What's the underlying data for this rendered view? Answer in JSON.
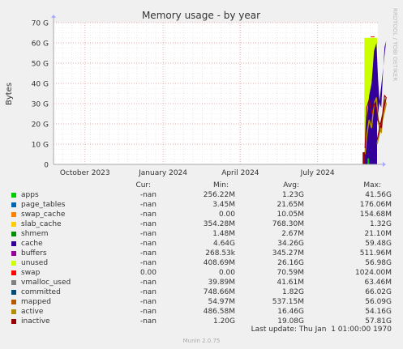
{
  "chart_data": {
    "type": "area",
    "title": "Memory usage - by year",
    "ylabel": "Bytes",
    "ylim": [
      0,
      70
    ],
    "yunit": "G",
    "y_ticks": [
      "0",
      "10 G",
      "20 G",
      "30 G",
      "40 G",
      "50 G",
      "60 G",
      "70 G"
    ],
    "x_ticks": [
      "October 2023",
      "January 2024",
      "April 2024",
      "July 2024"
    ],
    "x_range": [
      "2023-08-25",
      "2024-09-10"
    ],
    "grid": true,
    "data_start": "2024-08-25",
    "columns": {
      "cur": "Cur:",
      "min": "Min:",
      "avg": "Avg:",
      "max": "Max:"
    },
    "series": [
      {
        "name": "apps",
        "color": "#00cc00",
        "cur": "-nan",
        "min": "256.22M",
        "avg": "1.23G",
        "max": "41.56G"
      },
      {
        "name": "page_tables",
        "color": "#0066b3",
        "cur": "-nan",
        "min": "3.45M",
        "avg": "21.65M",
        "max": "176.06M"
      },
      {
        "name": "swap_cache",
        "color": "#ff8000",
        "cur": "-nan",
        "min": "0.00",
        "avg": "10.05M",
        "max": "154.68M"
      },
      {
        "name": "slab_cache",
        "color": "#ffcc00",
        "cur": "-nan",
        "min": "354.28M",
        "avg": "768.30M",
        "max": "1.32G"
      },
      {
        "name": "shmem",
        "color": "#008f00",
        "cur": "-nan",
        "min": "1.48M",
        "avg": "2.67M",
        "max": "21.10M"
      },
      {
        "name": "cache",
        "color": "#330099",
        "cur": "-nan",
        "min": "4.64G",
        "avg": "34.26G",
        "max": "59.48G"
      },
      {
        "name": "buffers",
        "color": "#990099",
        "cur": "-nan",
        "min": "268.53k",
        "avg": "345.27M",
        "max": "511.96M"
      },
      {
        "name": "unused",
        "color": "#ccff00",
        "cur": "-nan",
        "min": "408.69M",
        "avg": "26.16G",
        "max": "56.98G"
      },
      {
        "name": "swap",
        "color": "#ff0000",
        "cur": "0.00",
        "min": "0.00",
        "avg": "70.59M",
        "max": "1024.00M"
      },
      {
        "name": "vmalloc_used",
        "color": "#808080",
        "cur": "-nan",
        "min": "39.89M",
        "avg": "41.61M",
        "max": "63.46M"
      },
      {
        "name": "committed",
        "color": "#004d7a",
        "cur": "-nan",
        "min": "748.66M",
        "avg": "1.82G",
        "max": "66.02G"
      },
      {
        "name": "mapped",
        "color": "#b35a00",
        "cur": "-nan",
        "min": "54.97M",
        "avg": "537.15M",
        "max": "56.09G"
      },
      {
        "name": "active",
        "color": "#b38f00",
        "cur": "-nan",
        "min": "486.58M",
        "avg": "16.46G",
        "max": "54.16G"
      },
      {
        "name": "inactive",
        "color": "#990000",
        "cur": "-nan",
        "min": "1.20G",
        "avg": "19.08G",
        "max": "57.81G"
      }
    ]
  },
  "footer": "Last update: Thu Jan  1 01:00:00 1970",
  "munin_version": "Munin 2.0.75",
  "side_label": "RRDTOOL / TOBI OETIKER",
  "colors": {
    "background": "#f0f0f0",
    "plot": "#ffffff",
    "grid_major": "#e08080",
    "axis": "#cccccc"
  }
}
